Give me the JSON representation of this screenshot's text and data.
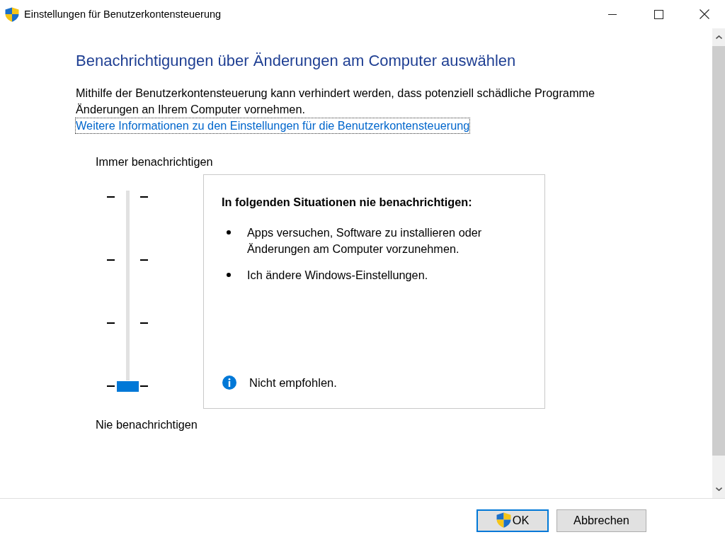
{
  "window": {
    "title": "Einstellungen für Benutzerkontensteuerung"
  },
  "heading": "Benachrichtigungen über Änderungen am Computer auswählen",
  "description": "Mithilfe der Benutzerkontensteuerung kann verhindert werden, dass potenziell schädliche Programme Änderungen an Ihrem Computer vornehmen.",
  "info_link": {
    "label": "Weitere Informationen zu den Einstellungen für die Benutzerkontensteuerung",
    "focused": true
  },
  "slider": {
    "top_label": "Immer benachrichtigen",
    "bottom_label": "Nie benachrichtigen",
    "level": 0
  },
  "details": {
    "title": "In folgenden Situationen nie benachrichtigen:",
    "items": [
      "Apps versuchen, Software zu installieren oder Änderungen am Computer vorzunehmen.",
      "Ich ändere Windows-Einstellungen."
    ],
    "note": "Nicht empfohlen."
  },
  "buttons": [
    {
      "label": "OK",
      "kind": "elevated",
      "default": true
    },
    {
      "label": "Abbrechen",
      "kind": "plain",
      "default": false
    }
  ]
}
